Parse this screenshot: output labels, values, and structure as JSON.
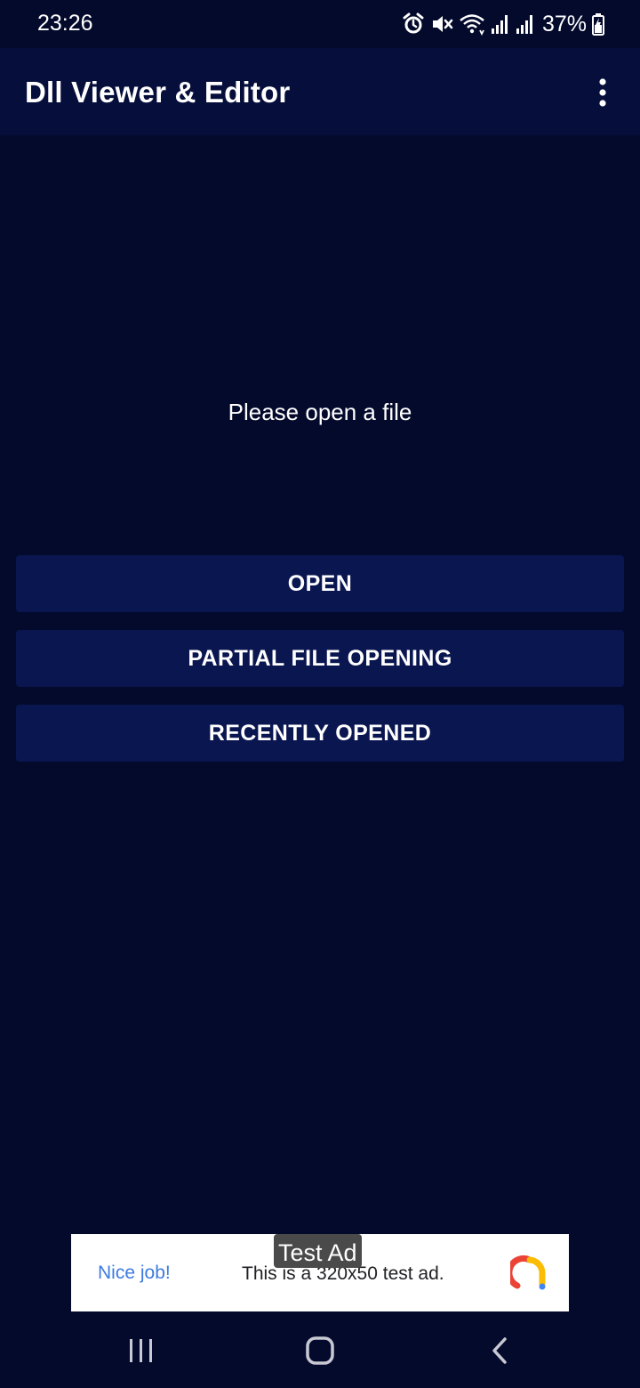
{
  "status_bar": {
    "time": "23:26",
    "battery_percent": "37%",
    "icons": [
      "alarm-icon",
      "mute-icon",
      "wifi-icon",
      "signal-icon",
      "signal-icon",
      "battery-charging-icon"
    ]
  },
  "app_bar": {
    "title": "Dll Viewer & Editor",
    "menu_icon": "more-vert-icon"
  },
  "main": {
    "message": "Please open a file",
    "buttons": {
      "open": "OPEN",
      "partial": "PARTIAL FILE OPENING",
      "recent": "RECENTLY OPENED"
    }
  },
  "ad": {
    "label": "Test Ad",
    "left_text": "Nice job!",
    "body_text": "This is a 320x50 test ad.",
    "logo_icon": "admob-logo-icon"
  },
  "nav_bar": {
    "recents_icon": "recents-icon",
    "home_icon": "home-icon",
    "back_icon": "back-icon"
  },
  "colors": {
    "background": "#040a2c",
    "app_bar": "#060f3c",
    "button": "#0a1650",
    "ad_link": "#3d7be0"
  }
}
